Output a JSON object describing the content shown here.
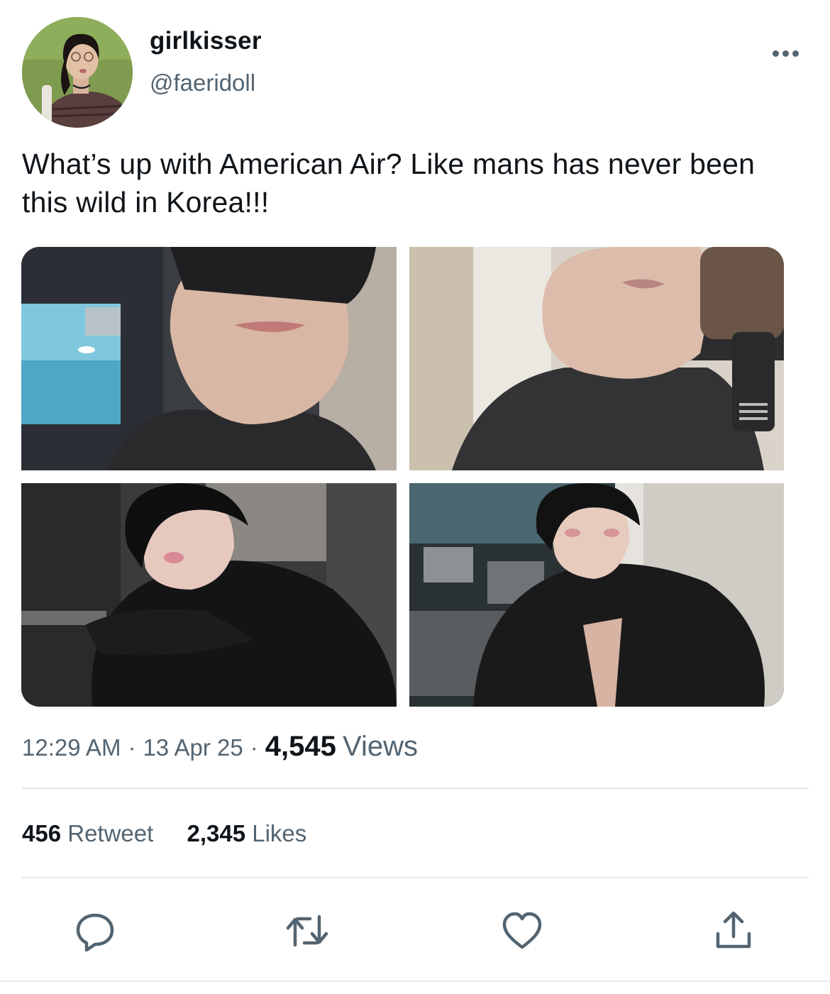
{
  "author": {
    "display_name": "girlkisser",
    "handle": "@faeridoll"
  },
  "tweet": {
    "text": "What’s up with American Air? Like mans has never been this wild in Korea!!!",
    "photo_count": 4
  },
  "meta": {
    "time": "12:29 AM",
    "date": "13 Apr 25",
    "views_count": "4,545",
    "views_label": "Views"
  },
  "stats": {
    "retweets_count": "456",
    "retweets_label": "Retweet",
    "likes_count": "2,345",
    "likes_label": "Likes"
  },
  "actions": [
    "reply-icon",
    "retweet-icon",
    "like-icon",
    "share-icon"
  ],
  "colors": {
    "text_primary": "#0f1419",
    "text_secondary": "#536471",
    "divider": "#e6e9eb",
    "icon": "#536471"
  }
}
